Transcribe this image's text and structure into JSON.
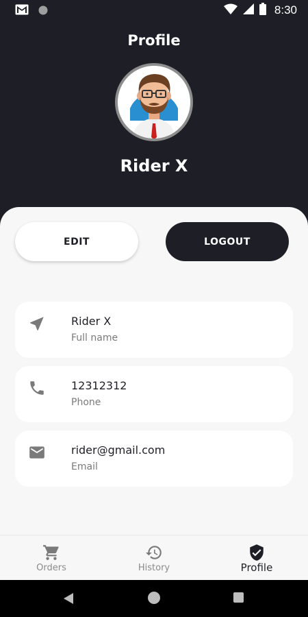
{
  "status_bar": {
    "time": "8:30"
  },
  "header": {
    "title": "Profile",
    "name": "Rider X"
  },
  "actions": {
    "edit_label": "EDIT",
    "logout_label": "LOGOUT"
  },
  "details": [
    {
      "icon": "navigation-arrow-icon",
      "value": "Rider X",
      "label": "Full name"
    },
    {
      "icon": "phone-icon",
      "value": "12312312",
      "label": "Phone"
    },
    {
      "icon": "email-icon",
      "value": "rider@gmail.com",
      "label": "Email"
    }
  ],
  "nav": {
    "items": [
      {
        "label": "Orders",
        "icon": "cart-icon"
      },
      {
        "label": "History",
        "icon": "history-icon"
      },
      {
        "label": "Profile",
        "icon": "shield-check-icon",
        "active": true
      }
    ]
  },
  "colors": {
    "dark": "#1e1f26",
    "sheet": "#f7f7f7",
    "card": "#ffffff",
    "muted": "#7a7a7a",
    "avatar_bg": "#2a8fd0"
  }
}
